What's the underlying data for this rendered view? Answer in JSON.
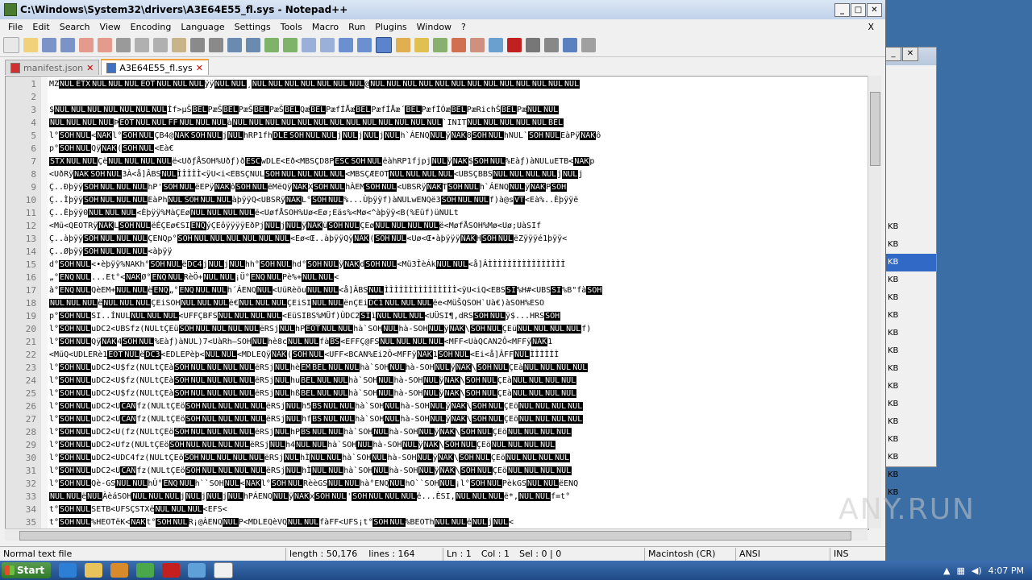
{
  "window": {
    "title": "C:\\Windows\\System32\\drivers\\A3E64E55_fl.sys - Notepad++"
  },
  "menu": [
    "File",
    "Edit",
    "Search",
    "View",
    "Encoding",
    "Language",
    "Settings",
    "Tools",
    "Macro",
    "Run",
    "Plugins",
    "Window",
    "?"
  ],
  "menu_close": "X",
  "tabs": [
    {
      "label": "manifest.json",
      "active": false
    },
    {
      "label": "A3E64E55_fl.sys",
      "active": true
    }
  ],
  "lines": [
    {
      "n": "1",
      "t": "MZ NUL ETX NUL NUL NUL EOT NUL NUL NUL ÿÿ NUL NUL ¸ NUL NUL NUL NUL NUL NUL NUL @ NUL NUL NUL NUL NUL NUL NUL NUL NUL NUL NUL NUL NUL"
    },
    {
      "n": "2",
      "t": ""
    },
    {
      "n": "3",
      "t": "$ NUL NUL NUL NUL NUL NUL NUL Íf>µŠ BEL PæŠ BEL PæŠ BEL PæŠ BEL Qæ BEL PæfÍÅæ BEL PæfÍÅæ´ BEL PæfÍÓæ BEL Pæ Rich Š BEL Pæ NUL NUL"
    },
    {
      "n": "4",
      "t": "NUL NUL NUL NUL Þ EOT NUL NUL FF NUL NUL NUL à NUL NUL NUL NUL NUL NUL NUL NUL NUL NUL NUL NUL NUL ` INIT NUL NUL NUL NUL NUL BEL"
    },
    {
      "n": "5",
      "t": "l° SOH NUL < NAK l° SOH NUL Ç B4@ NAK SOH NUL j NUL hRP1fh DLE SOH NUL NUL j NUL j NUL j NUL h`ÁENQ NUL ÿ NAK 8 SOH NUL hNUL` SOH NUL EàPÿ NAK ô"
    },
    {
      "n": "6",
      "t": "p° SOH NUL Qÿ NAK ( SOH NUL < Eà€"
    },
    {
      "n": "7",
      "t": "STX NUL NUL Çë NUL NUL NUL NUL ë < Uð ƒ ÅSOH%Uðƒ ) ð ESC wDLE < Eð< MBS ÇD8P ESC SOH NUL ëàhRP1fjpj NUL ÿ NAK $ SOH NUL %E àƒ ) àNUL uETB < NAK p"
    },
    {
      "n": "8",
      "t": "< UðRÿ NAK SOH NUL 3À< å] ÂBS NUL ÌÌÌÌÌ<ÿU< i< EBS ÇNUL SOH NUL NUL NUL NUL < MBS ÇÆEOT NUL NUL NUL NUL < UBS ÇBBS NUL NUL NUL NUL j NUL j"
    },
    {
      "n": "9",
      "t": "Ç..Ðþÿÿ SOH NUL NUL NUL hP' SOH NUL ëEPÿ NAK ô SOH NUL ëMëQÿ NAK X SOH NUL hÀEM SOH NUL < UBS Rÿ NAK T SOH NUL h`ÁENQ NUL ÿ NAK P SOH"
    },
    {
      "n": "10",
      "t": "Ç..Ìþÿÿ SOH NUL NUL NUL EàPh NUL SOH NUL NUL àþÿÿQ< UBS Rÿ NAK L° SOH NUL %...Ùþÿÿf) àNUL wENQ ë3 SOH NUL NUL f) à@s VT < Eà%..Èþÿÿë"
    },
    {
      "n": "11",
      "t": "Ç..Èþÿÿ0 NUL NUL NUL < Èþÿÿ%MàÇEø NUL NUL NUL NUL ë < UøfÅSOH%Uø< Eø; Eäs%< Mø<^àþÿÿ< B(%Eüf) üNUL t"
    },
    {
      "n": "12",
      "t": "< Mü< QEOT Rÿ NAK L SOH NUL ëÉÇEø€SI ENQ ýÇEôÿÿÿÿEðPj NUL j NUL ÿ NAK ü SOH NUL ÇEø NUL NUL NUL NUL ë < MøfÅSOH%Mø< Uø; UàSI f"
    },
    {
      "n": "13",
      "t": "Ç..àþÿÿ SOH NUL NUL NUL Ç ENQp° SOH NUL NUL NUL NUL NUL NUL < Eø< Œ..àþÿÿQÿ NAK ( SOH NUL < Uø<Œ•àþÿÿÿ NAK H SOH NUL ëZÿÿÿé1þÿÿ<"
    },
    {
      "n": "14",
      "t": "Ç..Øþÿÿ SOH NUL NUL NUL < àþÿÿ"
    },
    {
      "n": "15",
      "t": "d° SOH NUL < •èþÿÿ%NAK h° SOH NUL ë DC4 j NUL j NUL hh° SOH NUL hd° SOH NUL ÿ NAK d SOH NUL < Mü3ÎèÁk NUL NUL < å] ÂÌÌÌÌÌÌÌÌÌÌÌÌÌÌÌÌ"
    },
    {
      "n": "16",
      "t": "„° ENQ NUL ...Et°< NAK Ø° ENQ NUL RèÖ+ NUL NUL ¡Ü° ENQ NUL Pè%+ NUL NUL <"
    },
    {
      "n": "17",
      "t": "à° ENQ NUL Qè EM+ NUL NUL ë ENQ „° ENQ NUL NUL h´ÁENQ NUL < UüRèöu NUL NUL < å] ÂBS NUL ÌÌÌÌÌÌÌÌÌÌÌÌÌÌÌ<ÿU< iQ< EBS SI %H#< UBS SI %B\"fà SOH"
    },
    {
      "n": "18",
      "t": "NUL NUL NUL ë NUL NUL NUL Ç EiSOH NUL NUL NUL ë€ NUL NUL NUL Ç EiSI NUL NUL ënÇEi DC1 NUL NUL NUL ëe< MüŠQ SOH`Uà€) àSOH%ESO"
    },
    {
      "n": "19",
      "t": "p° SOH NUL SI..ÍNUL NUL NUL NUL < UFF Ç BFS NUL NUL NUL NUL < EüSI BS%MÜf) ÙDC2 SI ì NUL NUL NUL < UÜSI ¶, dRS SOH NUL ÿ$...HRS SOH"
    },
    {
      "n": "20",
      "t": "l° SOH NUL uDC2 < UBS fz(NUL t ÇEü SOH NUL NUL NUL NUL ëRS j NUL hP EOT NUL NUL hà`SOH NUL hà-SOH NUL ÿ NAK \\ SOH NUL ÇEü NUL NUL NUL NUL f)"
    },
    {
      "n": "21",
      "t": "l° SOH NUL Qÿ NAK 4 SOH NUL %Eàƒ) àNUL ) 7< UàRh–SOH NUL hè8c NUL NUL fà BS < EFFÇ@FS NUL NUL NUL NUL < MFF< UàQCAN 2 Ô< MFF ÿ NAK 1"
    },
    {
      "n": "22",
      "t": "< MüQ< UDLE Rè1 EOT NUL ë DC3 < EDLE Pèþ< NUL NUL < MDLE Qÿ NAK ( SOH NUL < UFF< BCAN %Ei2Ô< MFF ÿ NAK 1 SOH NUL < Ei< å] ÂFF NUL ÌÌÌÌÌÌ"
    },
    {
      "n": "23",
      "t": "l° SOH NUL uDC2 < U$fz(NUL t ÇEà SOH NUL NUL NUL NUL ëRS j NUL hè EM BEL NUL NUL hà`SOH NUL hà-SOH NUL ÿ NAK \\ SOH NUL ÇEà NUL NUL NUL NUL"
    },
    {
      "n": "24",
      "t": "l° SOH NUL uDC2 < U$fz(NUL t ÇEà SOH NUL NUL NUL NUL ëRS j NUL hu BEL NUL NUL hà`SOH NUL hà-SOH NUL ÿ NAK \\ SOH NUL ÇEà NUL NUL NUL NUL"
    },
    {
      "n": "25",
      "t": "l° SOH NUL uDC2 < U$fz(NUL t ÇEà SOH NUL NUL NUL NUL ëRS j NUL hß BEL NUL NUL hà`SOH NUL hà-SOH NUL ÿ NAK \\ SOH NUL ÇEà NUL NUL NUL NUL"
    },
    {
      "n": "26",
      "t": "l° SOH NUL uDC2 < U CAN fz(NUL t ÇEö SOH NUL NUL NUL NUL ëRS j NUL h5 BS NUL NUL hà`SOH NUL hà-SOH NUL ÿ NAK \\ SOH NUL ÇEö NUL NUL NUL NUL"
    },
    {
      "n": "27",
      "t": "l° SOH NUL uDC2 < U CAN fz(NUL t ÇEö SOH NUL NUL NUL NUL ëRS j NUL hf BS NUL NUL hà`SOH NUL hà-SOH NUL ÿ NAK \\ SOH NUL ÇEö NUL NUL NUL NUL"
    },
    {
      "n": "28",
      "t": "l° SOH NUL uDC2 < U(fz(NUL t ÇEö SOH NUL NUL NUL NUL ëRS j NUL hP BS NUL NUL hà`SOH NUL hà-SOH NUL ÿ NAK \\ SOH NUL ÇEö NUL NUL NUL NUL"
    },
    {
      "n": "29",
      "t": "l° SOH NUL uDC2 < U fz(NUL t ÇEö SOH NUL NUL NUL NUL ëRS j NUL h4 NUL NUL hà`SOH NUL hà-SOH NUL ÿ NAK \\ SOH NUL ÇEö NUL NUL NUL NUL"
    },
    {
      "n": "30",
      "t": "l° SOH NUL uDC2 < UDC4 fz(NUL t ÇEö SOH NUL NUL NUL NUL ëRS j NUL hÌ NUL NUL hà`SOH NUL hà-SOH NUL ÿ NAK \\ SOH NUL ÇEö NUL NUL NUL NUL"
    },
    {
      "n": "31",
      "t": "l° SOH NUL uDC2 < U CAN fz(NUL t ÇEö SOH NUL NUL NUL NUL ëRS j NUL hÌ NUL NUL hà`SOH NUL hà-SOH NUL ÿ NAK \\ SOH NUL ÇEö NUL NUL NUL NUL"
    },
    {
      "n": "32",
      "t": "l° SOH NUL Qè-GS NUL NUL hÛ° ENQ NUL h``SOH NUL < NAK l° SOH NUL RèèGS NUL NUL hà°ENQ NUL hO``SOH NUL ¡ l° SOH NUL PèkGS NUL NUL ëENQ"
    },
    {
      "n": "33",
      "t": "NUL NUL ë NUL ÀèáSOH NUL NUL NUL j NUL j NUL j NUL hPÁENQ NUL ÿ NAK x SOH NUL ' SOH NUL NUL NUL ë ...ÈSI, NUL NUL NUL ë*, NUL NUL f=t°"
    },
    {
      "n": "34",
      "t": "t° SOH NUL SETB < UFS ÇSTX ë NUL NUL NUL < EFS <"
    },
    {
      "n": "35",
      "t": "t° SOH NUL %HEOT ëK< NAK t° SOH NUL R¡@ÀENQ NUL P< MDLE QèVQ NUL NUL fà FF< UFS ¡t° SOH NUL %BEOT h NUL NUL ë NUL j NUL <"
    }
  ],
  "status": {
    "type": "Normal text file",
    "length": "length : 50,176",
    "lines": "lines : 164",
    "ln": "Ln : 1",
    "col": "Col : 1",
    "sel": "Sel : 0 | 0",
    "eol": "Macintosh (CR)",
    "encoding": "ANSI",
    "ins": "INS"
  },
  "bg_window_rows": [
    "KB",
    "KB",
    "KB",
    "KB",
    "KB",
    "KB",
    "KB",
    "KB",
    "KB",
    "KB",
    "KB",
    "KB",
    "KB",
    "KB",
    "KB",
    "KB"
  ],
  "taskbar": {
    "start": "Start",
    "clock": "4:07 PM"
  },
  "watermark": "ANY.RUN",
  "colors": {
    "titlebar": "#c8d8ee",
    "taskbar": "#2b5a9a",
    "selected_row": "#3169c6"
  }
}
